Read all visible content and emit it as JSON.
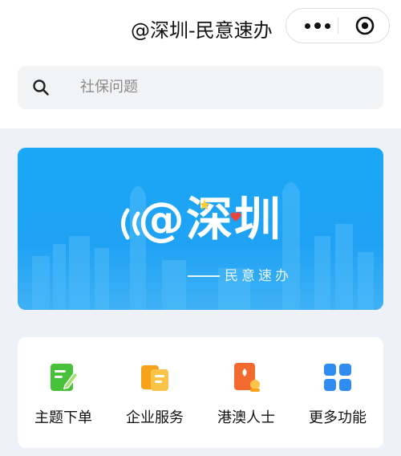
{
  "nav": {
    "title": "@深圳-民意速办"
  },
  "capsule": {
    "more_icon": "more-dots-icon",
    "close_icon": "target-circle-icon"
  },
  "search": {
    "placeholder": "社保问题",
    "icon": "search-icon"
  },
  "banner": {
    "brand": "@深圳",
    "slogan": "民意速办",
    "accent": "#1ba6f6"
  },
  "services": [
    {
      "label": "主题下单",
      "icon": "edit-document-icon",
      "color": "#47c23a"
    },
    {
      "label": "企业服务",
      "icon": "business-documents-icon",
      "color": "#f7a21b"
    },
    {
      "label": "港澳人士",
      "icon": "hk-passport-icon",
      "color": "#f26a2e"
    },
    {
      "label": "更多功能",
      "icon": "grid-apps-icon",
      "color": "#2f8cf1"
    }
  ]
}
